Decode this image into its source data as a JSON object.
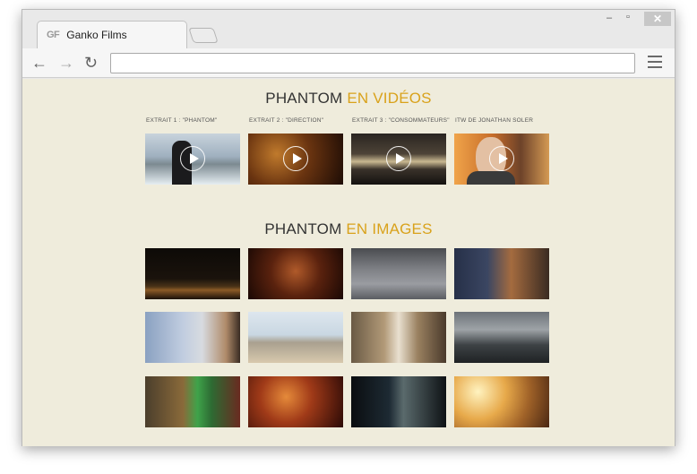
{
  "browser": {
    "tab_title": "Ganko Films",
    "favicon_text": "GF",
    "address": "",
    "controls": {
      "minimize": "–",
      "maximize": "▫",
      "close": "✕"
    },
    "nav": {
      "back": "←",
      "forward": "→",
      "reload": "↻"
    }
  },
  "page": {
    "videos_title": {
      "main": "PHANTOM",
      "accent": "EN VIDÉOS"
    },
    "images_title": {
      "main": "PHANTOM",
      "accent": "EN IMAGES"
    },
    "videos": [
      {
        "label": "EXTRAIT 1 : \"PHANTOM\""
      },
      {
        "label": "EXTRAIT 2 : \"DIRECTION\""
      },
      {
        "label": "EXTRAIT 3 : \"CONSOMMATEURS\""
      },
      {
        "label": "ITW DE JONATHAN SOLER"
      }
    ]
  },
  "colors": {
    "accent": "#d9a21b",
    "page_bg": "#efecdc"
  }
}
